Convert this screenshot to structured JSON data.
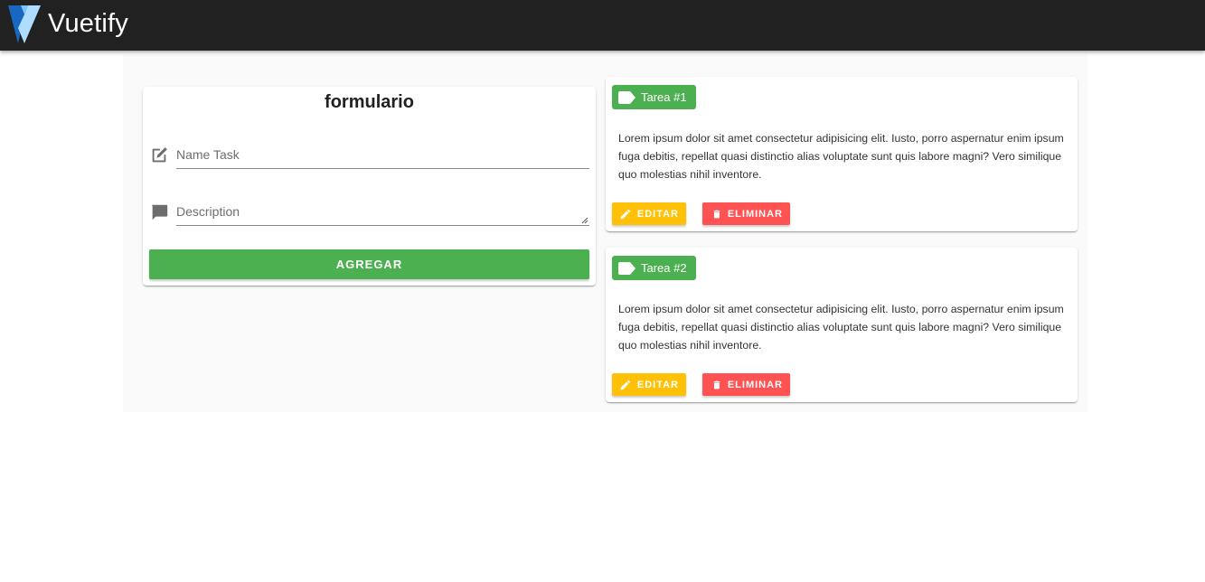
{
  "appbar": {
    "title": "Vuetify",
    "logo_icon": "vuetify-logo",
    "background": "#212121"
  },
  "form": {
    "title": "formulario",
    "name_field": {
      "placeholder": "Name Task",
      "value": "",
      "icon": "edit-icon"
    },
    "description_field": {
      "placeholder": "Description",
      "value": "",
      "icon": "comment-icon"
    },
    "submit_label": "AGREGAR"
  },
  "tasks": [
    {
      "label": "Tarea #1",
      "text": "Lorem ipsum dolor sit amet consectetur adipisicing elit. Iusto, porro aspernatur enim ipsum fuga debitis, repellat quasi distinctio alias voluptate sunt quis labore magni? Vero similique quo molestias nihil inventore.",
      "edit_label": "EDITAR",
      "delete_label": "ELIMINAR"
    },
    {
      "label": "Tarea #2",
      "text": "Lorem ipsum dolor sit amet consectetur adipisicing elit. Iusto, porro aspernatur enim ipsum fuga debitis, repellat quasi distinctio alias voluptate sunt quis labore magni? Vero similique quo molestias nihil inventore.",
      "edit_label": "EDITAR",
      "delete_label": "ELIMINAR"
    }
  ],
  "colors": {
    "success": "#4caf50",
    "warning": "#ffc107",
    "error": "#ff5252"
  }
}
